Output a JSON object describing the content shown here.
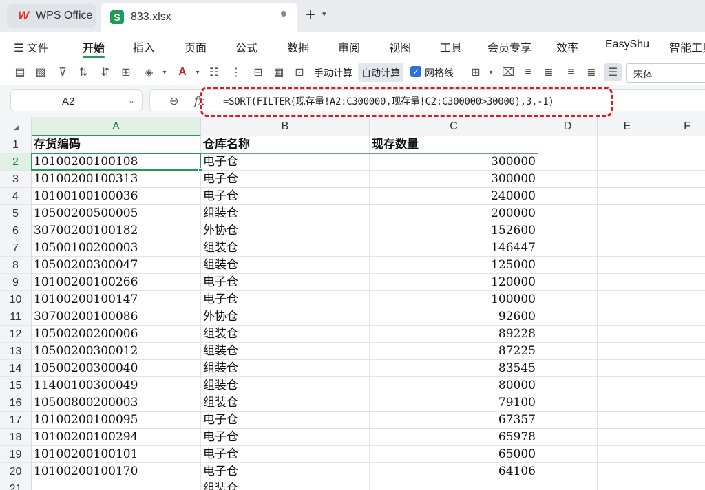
{
  "app": {
    "home_tab": "WPS Office",
    "file_tab": "833.xlsx",
    "file_icon_letter": "S",
    "new_tab": "+"
  },
  "menu": {
    "hamburger": "☰ 文件",
    "items": [
      "开始",
      "插入",
      "页面",
      "公式",
      "数据",
      "审阅",
      "视图",
      "工具",
      "会员专享",
      "效率",
      "EasyShu",
      "智能工具"
    ],
    "active": "开始"
  },
  "toolbar": {
    "manual_calc": "手动计算",
    "auto_calc": "自动计算",
    "gridlines": "网格线",
    "font_name": "宋体"
  },
  "formula_bar": {
    "name_box": "A2",
    "fx": "fx",
    "formula": "=SORT(FILTER(现存量!A2:C300000,现存量!C2:C300000>30000),3,-1)"
  },
  "columns": [
    "A",
    "B",
    "C",
    "D",
    "E",
    "F"
  ],
  "rows": [
    {
      "n": "1",
      "a": "存货编码",
      "b": "仓库名称",
      "c": "现存数量"
    },
    {
      "n": "2",
      "a": "10100200100108",
      "b": "电子仓",
      "c": "300000"
    },
    {
      "n": "3",
      "a": "10100200100313",
      "b": "电子仓",
      "c": "300000"
    },
    {
      "n": "4",
      "a": "10100100100036",
      "b": "电子仓",
      "c": "240000"
    },
    {
      "n": "5",
      "a": "10500200500005",
      "b": "组装仓",
      "c": "200000"
    },
    {
      "n": "6",
      "a": "30700200100182",
      "b": "外协仓",
      "c": "152600"
    },
    {
      "n": "7",
      "a": "10500100200003",
      "b": "组装仓",
      "c": "146447"
    },
    {
      "n": "8",
      "a": "10500200300047",
      "b": "组装仓",
      "c": "125000"
    },
    {
      "n": "9",
      "a": "10100200100266",
      "b": "电子仓",
      "c": "120000"
    },
    {
      "n": "10",
      "a": "10100200100147",
      "b": "电子仓",
      "c": "100000"
    },
    {
      "n": "11",
      "a": "30700200100086",
      "b": "外协仓",
      "c": "92600"
    },
    {
      "n": "12",
      "a": "10500200200006",
      "b": "组装仓",
      "c": "89228"
    },
    {
      "n": "13",
      "a": "10500200300012",
      "b": "组装仓",
      "c": "87225"
    },
    {
      "n": "14",
      "a": "10500200300040",
      "b": "组装仓",
      "c": "83545"
    },
    {
      "n": "15",
      "a": "11400100300049",
      "b": "组装仓",
      "c": "80000"
    },
    {
      "n": "16",
      "a": "10500800200003",
      "b": "组装仓",
      "c": "79100"
    },
    {
      "n": "17",
      "a": "10100200100095",
      "b": "电子仓",
      "c": "67357"
    },
    {
      "n": "18",
      "a": "10100200100294",
      "b": "电子仓",
      "c": "65978"
    },
    {
      "n": "19",
      "a": "10100200100101",
      "b": "电子仓",
      "c": "65000"
    },
    {
      "n": "20",
      "a": "10100200100170",
      "b": "电子仓",
      "c": "64106"
    },
    {
      "n": "21",
      "a": "",
      "b": "组装仓",
      "c": ""
    }
  ],
  "selected_cell": "A2",
  "colors": {
    "accent_green": "#1f9d55",
    "highlight_red": "#e5171f",
    "spill_blue": "#6a8bd6"
  }
}
